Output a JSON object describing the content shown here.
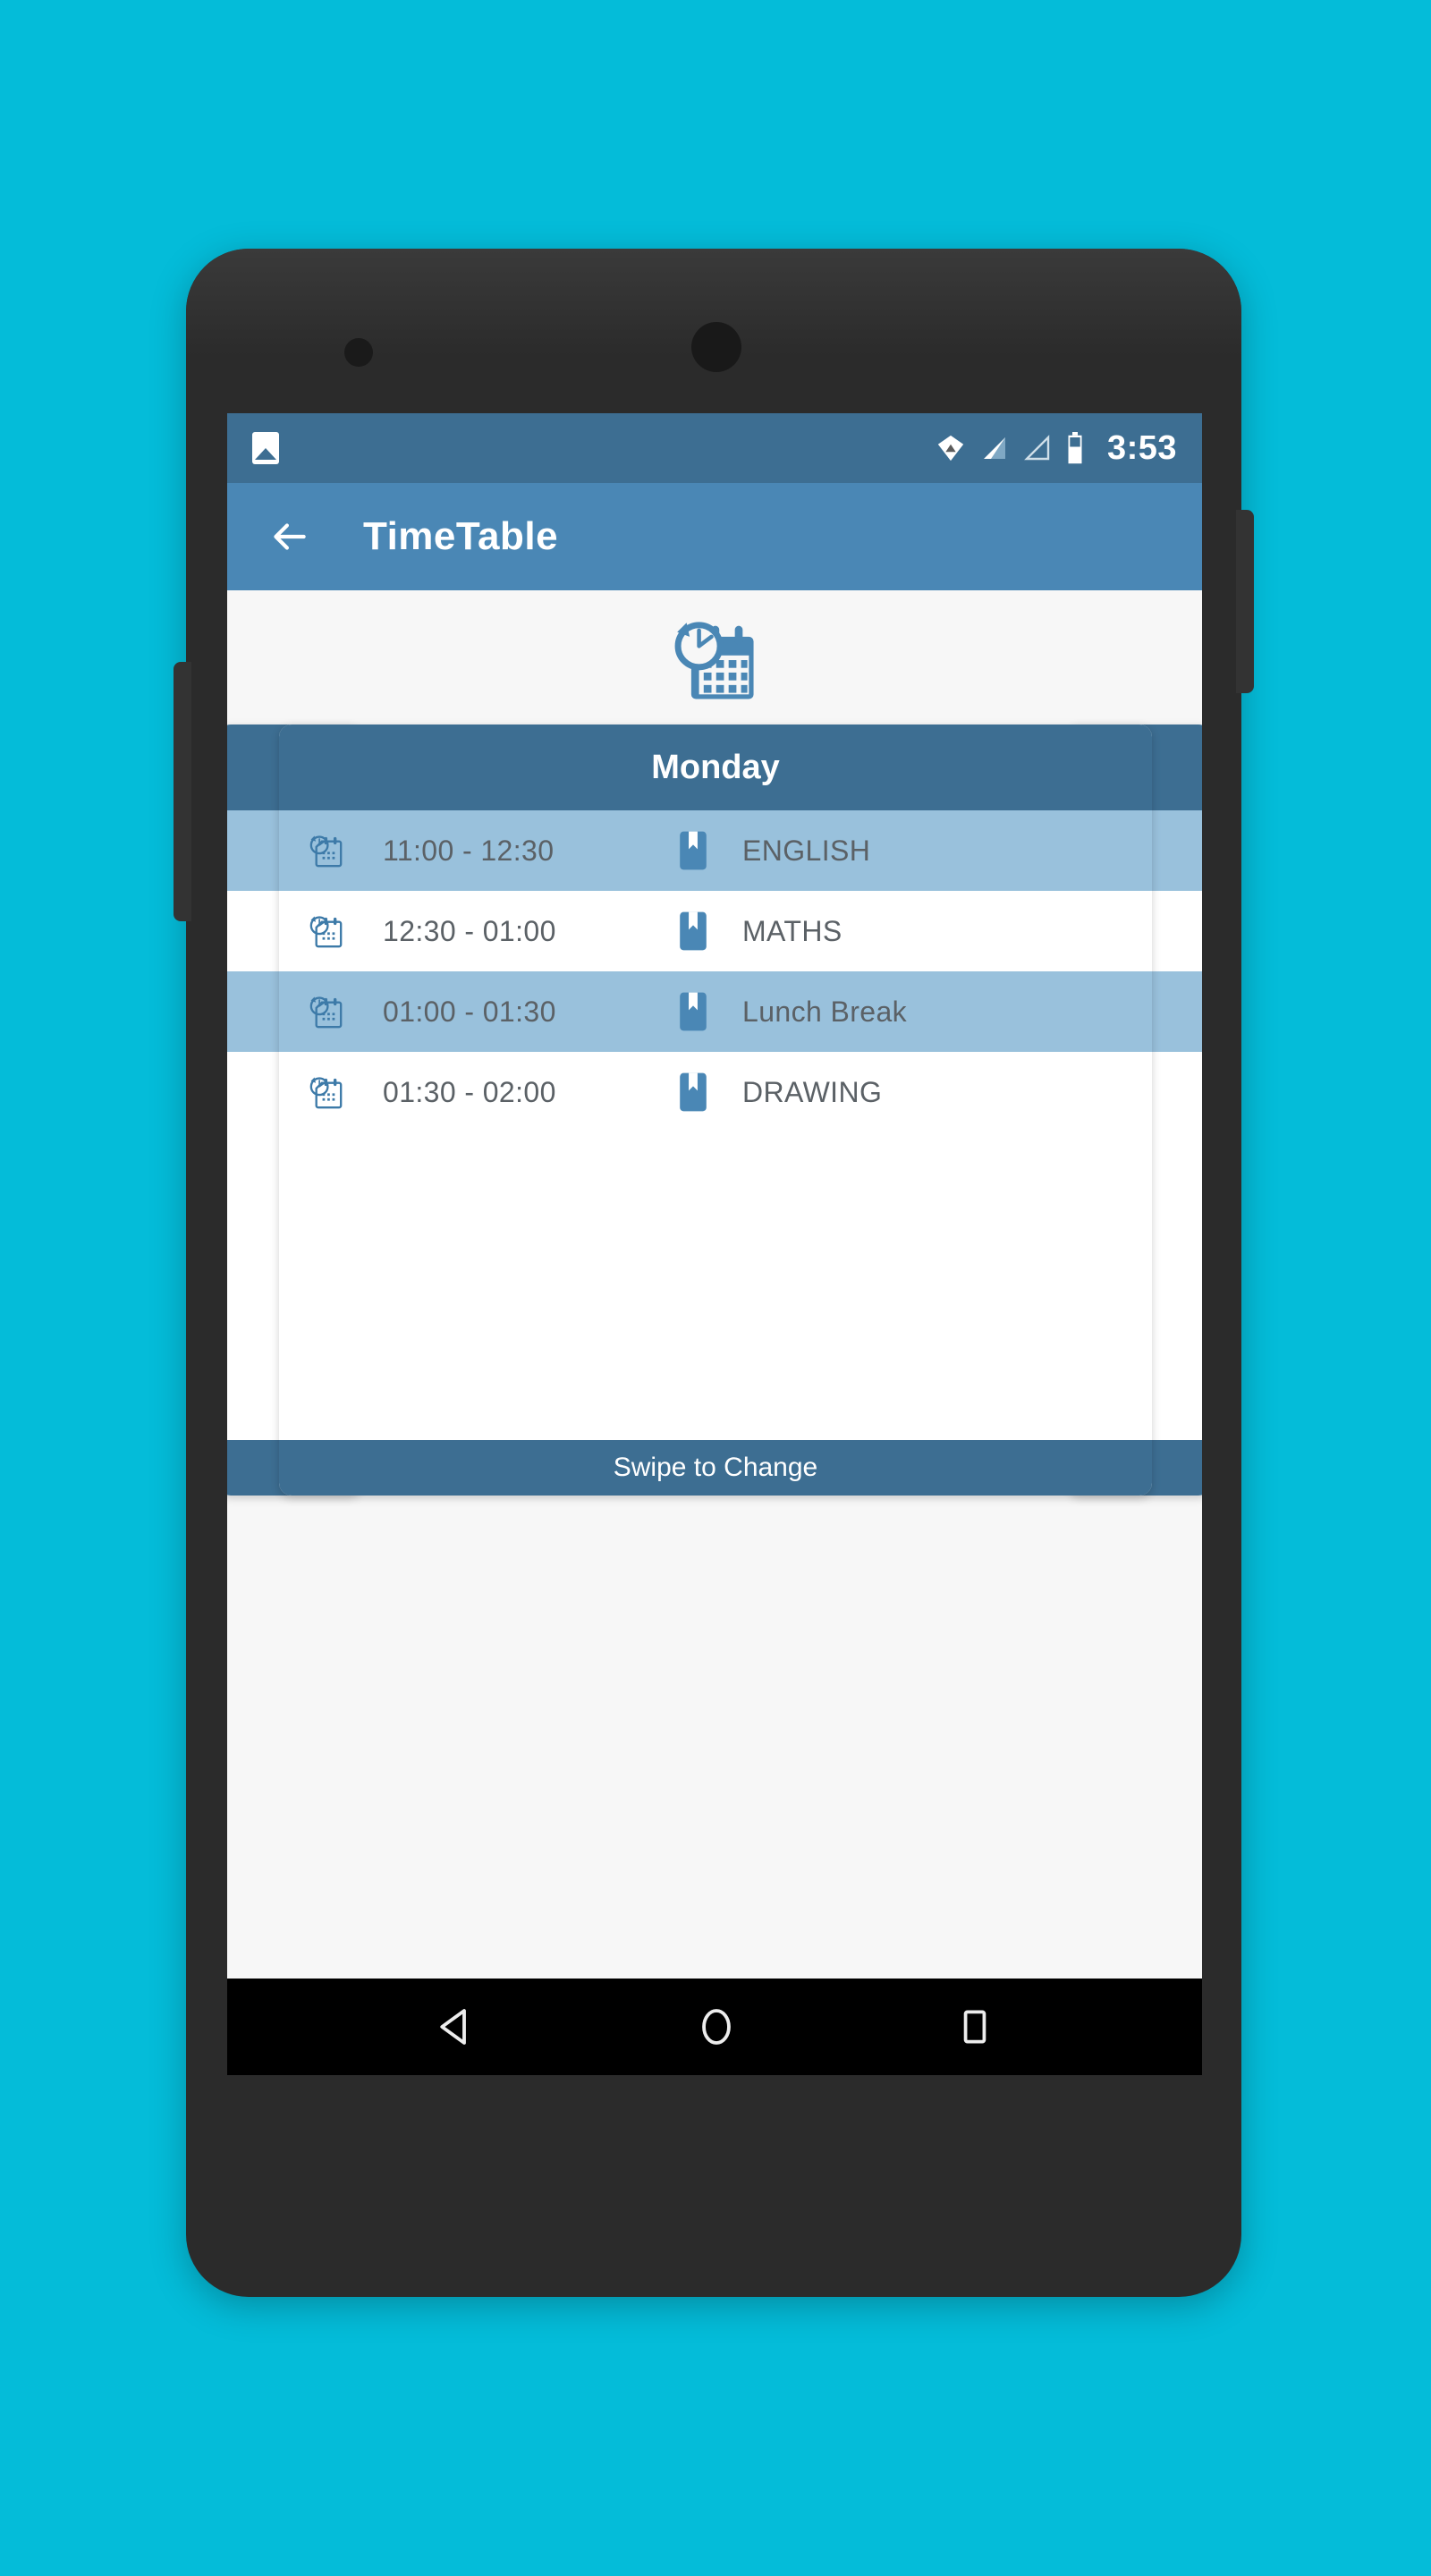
{
  "theme": {
    "page_background": "#04BCD9",
    "status_bar_bg": "#3d6e92",
    "app_bar_bg": "#4a87b5",
    "card_header_bg": "#3d6e92",
    "row_alt_bg": "#99c1dc",
    "accent": "#4a87b5",
    "text_primary": "#5b6166"
  },
  "status_bar": {
    "photo_icon": "photo-icon",
    "wifi_icon": "wifi-icon",
    "signal_icon_1": "signal-bars-icon",
    "signal_icon_2": "signal-bars-empty-icon",
    "battery_icon": "battery-icon",
    "clock": "3:53"
  },
  "app_bar": {
    "back_icon": "arrow-back-icon",
    "title": "TimeTable"
  },
  "logo": {
    "icon": "clock-calendar-icon"
  },
  "pager": {
    "current_card": {
      "day": "Monday",
      "footer_label": "Swipe to Change",
      "rows": [
        {
          "time_icon": "clock-calendar-icon",
          "time": "11:00 - 12:30",
          "subject_icon": "bookmark-icon",
          "subject": "ENGLISH"
        },
        {
          "time_icon": "clock-calendar-icon",
          "time": "12:30 - 01:00",
          "subject_icon": "bookmark-icon",
          "subject": "MATHS"
        },
        {
          "time_icon": "clock-calendar-icon",
          "time": "01:00 - 01:30",
          "subject_icon": "bookmark-icon",
          "subject": "Lunch Break"
        },
        {
          "time_icon": "clock-calendar-icon",
          "time": "01:30 - 02:00",
          "subject_icon": "bookmark-icon",
          "subject": "DRAWING"
        }
      ]
    }
  },
  "nav_bar": {
    "back_icon": "nav-back-triangle-icon",
    "home_icon": "nav-home-circle-icon",
    "recents_icon": "nav-recents-square-icon"
  }
}
